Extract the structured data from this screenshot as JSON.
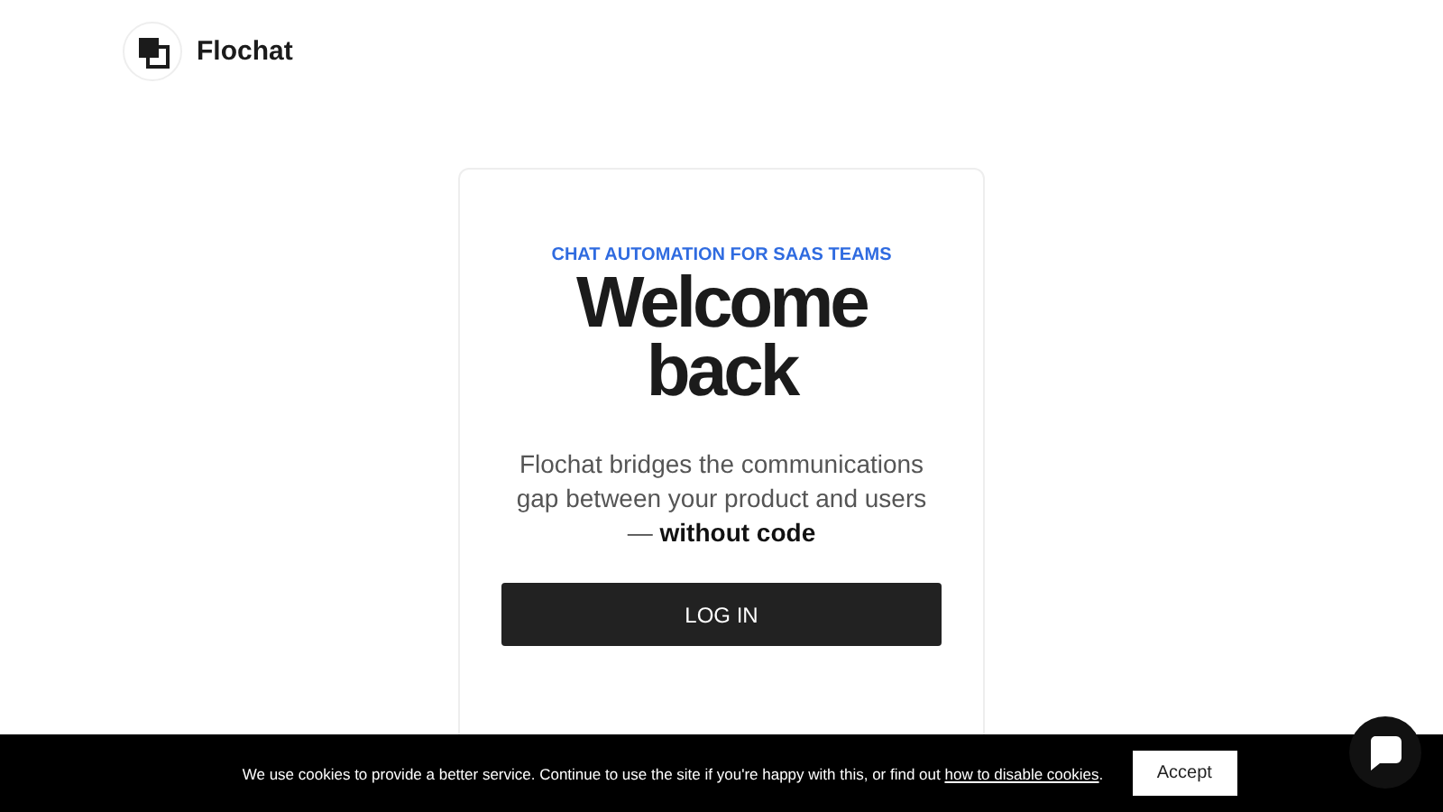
{
  "header": {
    "brand": "Flochat"
  },
  "card": {
    "eyebrow": "CHAT AUTOMATION FOR SAAS TEAMS",
    "title": "Welcome back",
    "description": "Flochat bridges the communications gap between your product and users — **without code**",
    "button": "LOG IN"
  },
  "cookie_banner": {
    "text": "We use cookies to provide a better service. Continue to use the site if you're happy with this, or find out ",
    "link": "how to disable cookies",
    "text_end": ".",
    "button": "Accept"
  }
}
